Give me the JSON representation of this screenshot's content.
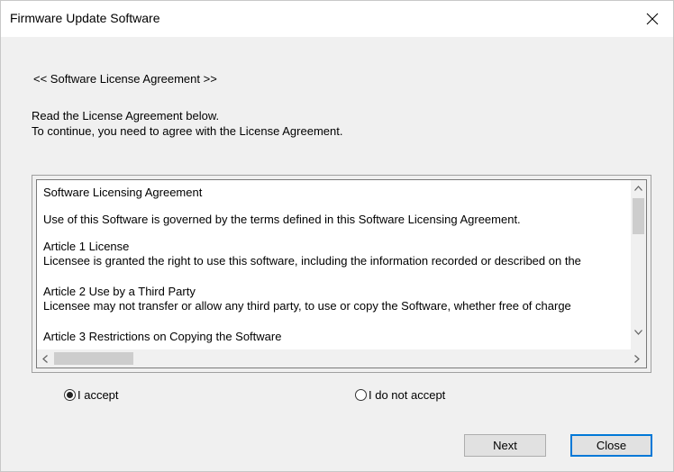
{
  "window": {
    "title": "Firmware Update Software"
  },
  "header": {
    "section_heading": "<< Software License Agreement >>",
    "instruction_1": "Read the License Agreement below.",
    "instruction_2": "To continue, you need to agree with the License Agreement."
  },
  "license": {
    "lines": [
      "Software Licensing Agreement",
      "Use of this Software is governed by the terms defined in this Software Licensing Agreement.",
      "Article 1 License",
      "Licensee is granted the right to use this software, including the information recorded or described on the",
      "Article 2 Use by a Third Party",
      "Licensee may not transfer or allow any third party, to use or copy the Software, whether free of charge",
      "Article 3 Restrictions on Copying the Software"
    ]
  },
  "radios": {
    "accept_label": "I accept",
    "decline_label": "I do not accept",
    "selected": "accept"
  },
  "buttons": {
    "next": "Next",
    "close": "Close"
  },
  "icons": {
    "window_close": "close-icon",
    "scroll_up": "chevron-up-icon",
    "scroll_down": "chevron-down-icon",
    "scroll_left": "chevron-left-icon",
    "scroll_right": "chevron-right-icon"
  },
  "colors": {
    "focus_border": "#0078d7"
  }
}
